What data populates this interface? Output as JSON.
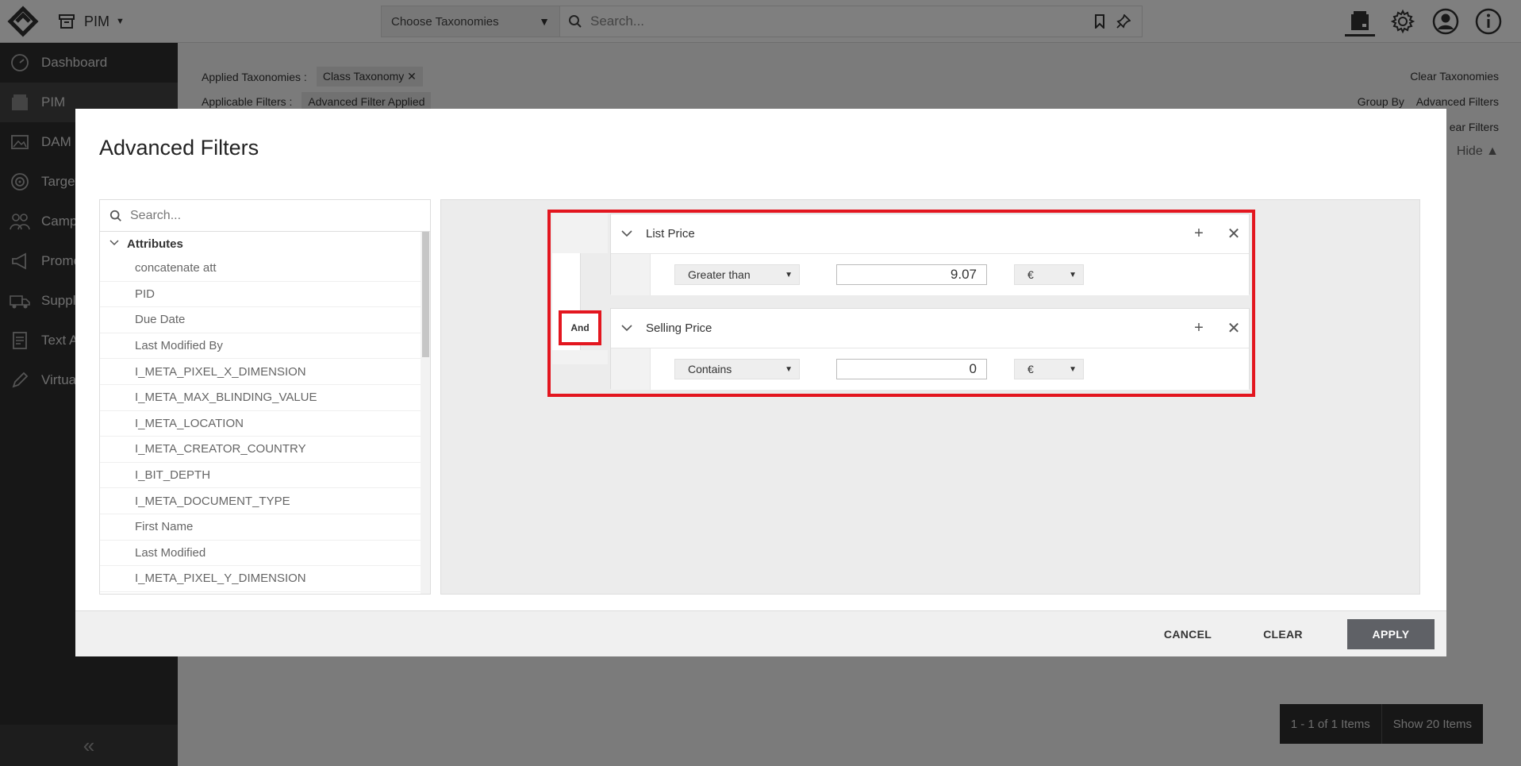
{
  "topbar": {
    "app_name": "PIM",
    "taxonomy_select": "Choose Taxonomies",
    "search_placeholder": "Search..."
  },
  "sidebar": {
    "items": [
      {
        "label": "Dashboard",
        "icon": "gauge-icon"
      },
      {
        "label": "PIM",
        "icon": "box-icon"
      },
      {
        "label": "DAM",
        "icon": "image-icon"
      },
      {
        "label": "Target",
        "icon": "target-icon"
      },
      {
        "label": "Campa",
        "icon": "people-icon"
      },
      {
        "label": "Promo",
        "icon": "megaphone-icon"
      },
      {
        "label": "Suppl",
        "icon": "truck-icon"
      },
      {
        "label": "Text A",
        "icon": "document-icon"
      },
      {
        "label": "Virtua",
        "icon": "pen-icon"
      }
    ],
    "collapse": "«"
  },
  "content": {
    "applied_taxonomies_label": "Applied Taxonomies :",
    "applied_taxonomy_chip": "Class Taxonomy",
    "applicable_filters_label": "Applicable Filters :",
    "applicable_filter_chip": "Advanced Filter Applied",
    "clear_taxonomies": "Clear Taxonomies",
    "group_by": "Group By",
    "advanced_filters_link": "Advanced Filters",
    "clear_filters": "ear Filters",
    "hide": "Hide",
    "pager_range": "1 - 1 of 1 Items",
    "pager_show": "Show 20 Items"
  },
  "modal": {
    "title": "Advanced Filters",
    "attr_search_placeholder": "Search...",
    "tree_root": "Attributes",
    "attributes": [
      "concatenate att",
      "PID",
      "Due Date",
      "Last Modified By",
      "I_META_PIXEL_X_DIMENSION",
      "I_META_MAX_BLINDING_VALUE",
      "I_META_LOCATION",
      "I_META_CREATOR_COUNTRY",
      "I_BIT_DEPTH",
      "I_META_DOCUMENT_TYPE",
      "First Name",
      "Last Modified",
      "I_META_PIXEL_Y_DIMENSION"
    ],
    "conjunction": "And",
    "conditions": [
      {
        "attribute": "List Price",
        "operator": "Greater than",
        "value": "9.07",
        "currency": "€"
      },
      {
        "attribute": "Selling Price",
        "operator": "Contains",
        "value": "0",
        "currency": "€"
      }
    ],
    "cancel": "CANCEL",
    "clear": "CLEAR",
    "apply": "APPLY"
  }
}
